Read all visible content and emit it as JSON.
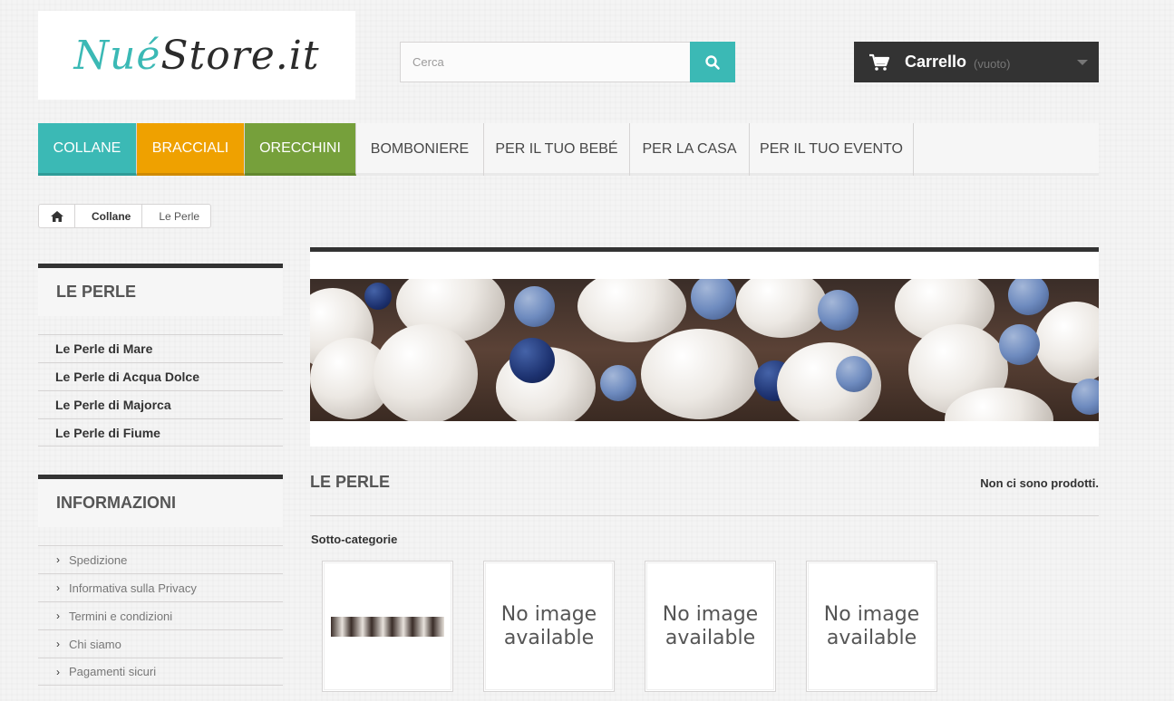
{
  "header": {
    "logo": {
      "part1": "Nué",
      "part2": "Store.it"
    },
    "search": {
      "placeholder": "Cerca"
    },
    "cart": {
      "label": "Carrello",
      "status": "(vuoto)"
    }
  },
  "menu": {
    "items": [
      {
        "label": "COLLANE",
        "color": "#3bb9b5"
      },
      {
        "label": "BRACCIALI",
        "color": "#efa100"
      },
      {
        "label": "ORECCHINI",
        "color": "#76a03b"
      },
      {
        "label": "BOMBONIERE"
      },
      {
        "label": "PER IL TUO BEBÉ"
      },
      {
        "label": "PER LA CASA"
      },
      {
        "label": "PER IL TUO EVENTO"
      }
    ]
  },
  "breadcrumb": {
    "home_icon": "home-icon",
    "items": [
      "Collane",
      "Le Perle"
    ]
  },
  "sidebar": {
    "category": {
      "title": "LE PERLE",
      "items": [
        "Le Perle di Mare",
        "Le Perle di Acqua Dolce",
        "Le Perle di Majorca",
        "Le Perle di Fiume"
      ]
    },
    "info": {
      "title": "INFORMAZIONI",
      "items": [
        "Spedizione",
        "Informativa sulla Privacy",
        "Termini e condizioni",
        "Chi siamo",
        "Pagamenti sicuri"
      ]
    }
  },
  "main": {
    "category_title": "LE PERLE",
    "no_products": "Non ci sono prodotti.",
    "subcategories_label": "Sotto-categorie",
    "subcategories": [
      {
        "image": "pearl-thumbnail"
      },
      {
        "no_image": "No image available"
      },
      {
        "no_image": "No image available"
      },
      {
        "no_image": "No image available"
      }
    ]
  },
  "colors": {
    "accent": "#3bb9b5",
    "dark": "#333333"
  }
}
